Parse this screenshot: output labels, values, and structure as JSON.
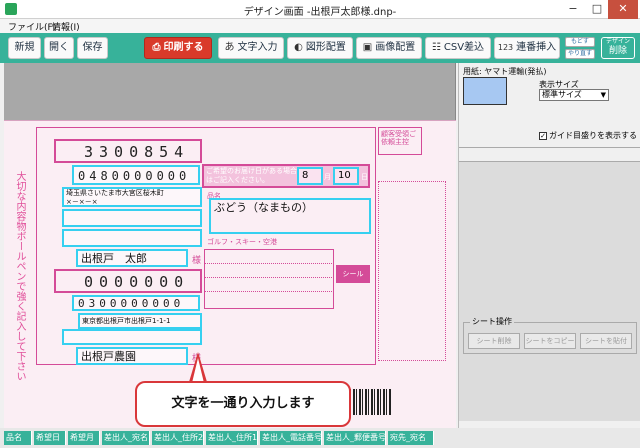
{
  "window": {
    "title": "デザイン画面 -出根戸太郎様.dnp-",
    "min": "−",
    "max": "□",
    "close": "✕"
  },
  "menu": {
    "file": "ファイル(F)",
    "info": "情報(I)"
  },
  "toolbar": {
    "new": "新規",
    "open": "開く",
    "save": "保存",
    "print": "印刷する",
    "text_input": "文字入力",
    "shape_place": "図形配置",
    "image_place": "画像配置",
    "csv_insert": "CSV差込",
    "serial_insert": "連番挿入",
    "undo": "もどす",
    "redo": "やり直す",
    "design_label": "デザイン",
    "delete": "削除",
    "text_icon": "あ",
    "serial_icon": "123"
  },
  "slip": {
    "sender_zip": "3300854",
    "sender_phone": "0480000000",
    "sender_addr1": "埼玉県さいたま市大宮区桜木町",
    "sender_addr2": "×－×－×",
    "sender_name": "出根戸　太郎",
    "recipient_zip": "0000000",
    "recipient_phone": "0300000000",
    "recipient_addr": "東京都出根戸市出根戸1-1-1",
    "recipient_name": "出根戸農園",
    "sama": "様",
    "item_name": "ぶどう（なまもの）",
    "delivery_month": "8",
    "delivery_day": "10",
    "month_label": "月",
    "day_label": "日",
    "delivery_note": "ご希望のお届け日がある場合はご記入ください。",
    "item_label": "品名",
    "golf_label": "ゴルフ・スキー・空港",
    "side_text": "大切な内容物ボールペンで強く記入して下さい",
    "stamp_text": "顧客受領ご依頼主控",
    "seal": "シール"
  },
  "callout": {
    "text": "文字を一通り入力します"
  },
  "right_panel": {
    "use_label": "用紙: ヤマト運輸(発払)",
    "size_label": "表示サイズ",
    "size_value": "標準サイズ",
    "guide_label": "ガイド目盛りを表示する",
    "sheet_title": "シート操作",
    "sheet_delete": "シート削除",
    "sheet_copy": "シートをコピー",
    "sheet_paste": "シートを貼付",
    "swatch_color": "#a7c8f2"
  },
  "tabs": [
    "品名",
    "希望日",
    "希望月",
    "差出人_宛名",
    "差出人_住所2",
    "差出人_住所1",
    "差出人_電話番号",
    "差出人_郵便番号",
    "宛先_宛名"
  ]
}
